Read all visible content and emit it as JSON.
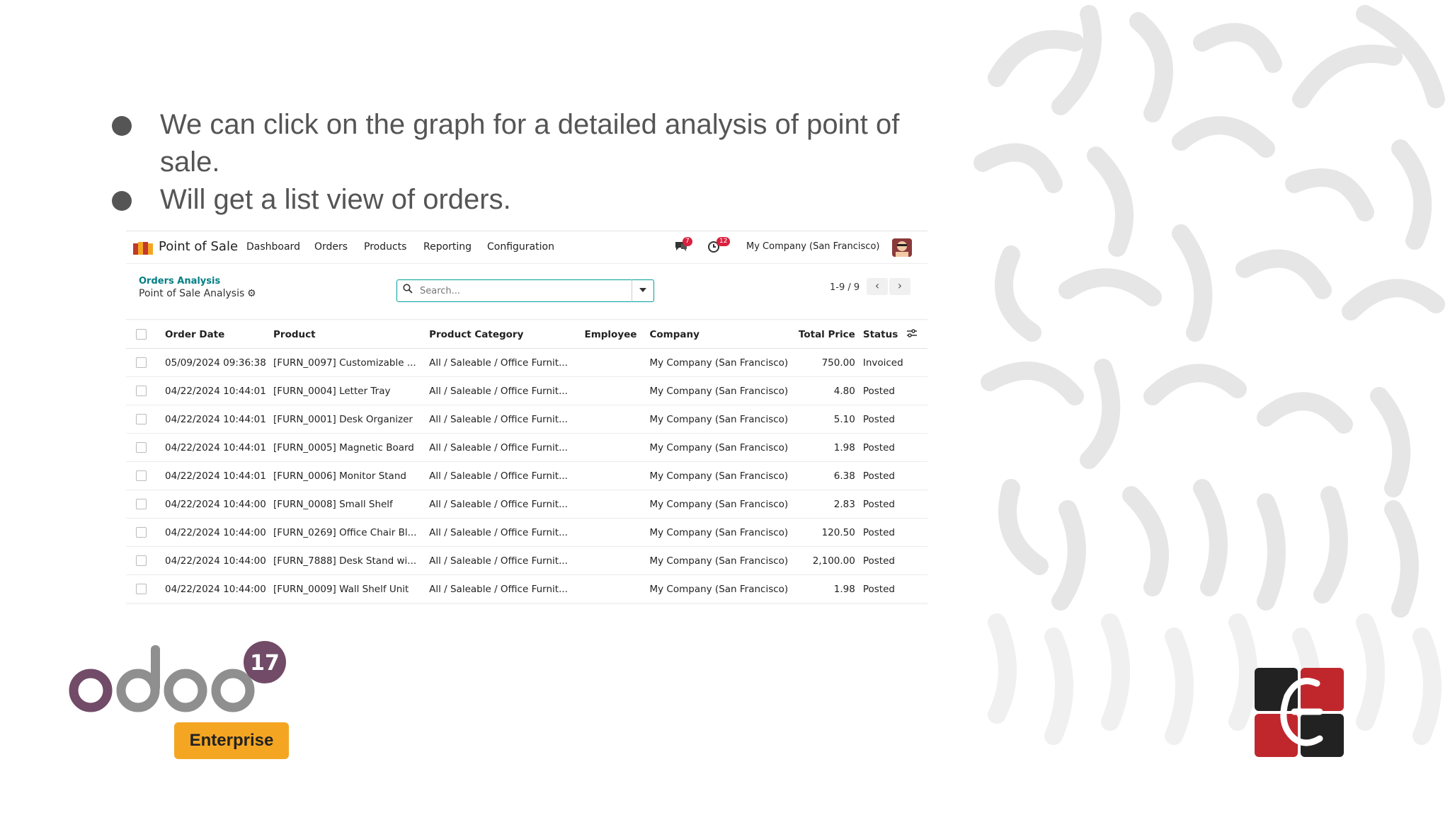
{
  "slide": {
    "bullets": [
      "We can click on the graph for a detailed analysis of point of sale.",
      "Will get a list view of orders."
    ]
  },
  "navbar": {
    "app_name": "Point of Sale",
    "menu": [
      "Dashboard",
      "Orders",
      "Products",
      "Reporting",
      "Configuration"
    ],
    "messages_badge": "7",
    "activities_badge": "12",
    "company": "My Company (San Francisco)"
  },
  "control_panel": {
    "breadcrumb_parent": "Orders Analysis",
    "breadcrumb_current": "Point of Sale Analysis",
    "search_placeholder": "Search...",
    "pager": "1-9 / 9"
  },
  "table": {
    "headers": [
      "Order Date",
      "Product",
      "Product Category",
      "Employee",
      "Company",
      "Total Price",
      "Status"
    ],
    "rows": [
      [
        "05/09/2024 09:36:38",
        "[FURN_0097] Customizable ...",
        "All / Saleable / Office Furnit...",
        "",
        "My Company (San Francisco)",
        "750.00",
        "Invoiced"
      ],
      [
        "04/22/2024 10:44:01",
        "[FURN_0004] Letter Tray",
        "All / Saleable / Office Furnit...",
        "",
        "My Company (San Francisco)",
        "4.80",
        "Posted"
      ],
      [
        "04/22/2024 10:44:01",
        "[FURN_0001] Desk Organizer",
        "All / Saleable / Office Furnit...",
        "",
        "My Company (San Francisco)",
        "5.10",
        "Posted"
      ],
      [
        "04/22/2024 10:44:01",
        "[FURN_0005] Magnetic Board",
        "All / Saleable / Office Furnit...",
        "",
        "My Company (San Francisco)",
        "1.98",
        "Posted"
      ],
      [
        "04/22/2024 10:44:01",
        "[FURN_0006] Monitor Stand",
        "All / Saleable / Office Furnit...",
        "",
        "My Company (San Francisco)",
        "6.38",
        "Posted"
      ],
      [
        "04/22/2024 10:44:00",
        "[FURN_0008] Small Shelf",
        "All / Saleable / Office Furnit...",
        "",
        "My Company (San Francisco)",
        "2.83",
        "Posted"
      ],
      [
        "04/22/2024 10:44:00",
        "[FURN_0269] Office Chair Bl...",
        "All / Saleable / Office Furnit...",
        "",
        "My Company (San Francisco)",
        "120.50",
        "Posted"
      ],
      [
        "04/22/2024 10:44:00",
        "[FURN_7888] Desk Stand wi...",
        "All / Saleable / Office Furnit...",
        "",
        "My Company (San Francisco)",
        "2,100.00",
        "Posted"
      ],
      [
        "04/22/2024 10:44:00",
        "[FURN_0009] Wall Shelf Unit",
        "All / Saleable / Office Furnit...",
        "",
        "My Company (San Francisco)",
        "1.98",
        "Posted"
      ]
    ]
  },
  "logos": {
    "odoo_version": "17",
    "edition": "Enterprise"
  },
  "colors": {
    "odoo_purple": "#714b67",
    "odoo_gray": "#8f8f8f",
    "enterprise_orange": "#f4a623",
    "accent_teal": "#017e84",
    "badge_red": "#d9213f"
  }
}
